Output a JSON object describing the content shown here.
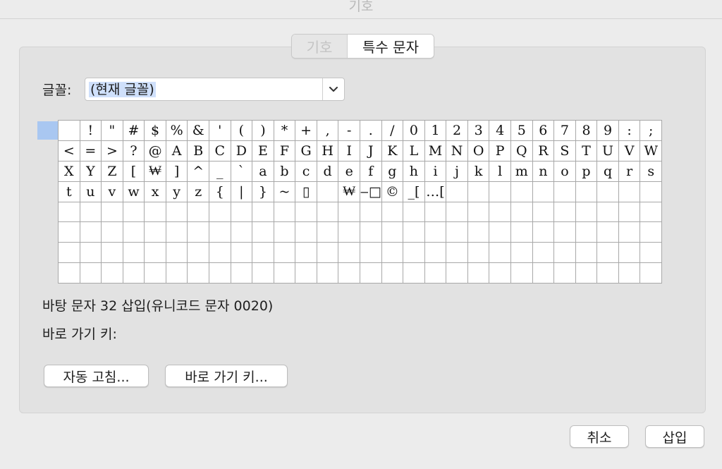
{
  "window": {
    "title": "기호"
  },
  "tabs": [
    {
      "label": "기호",
      "active": false
    },
    {
      "label": "특수 문자",
      "active": true
    }
  ],
  "font": {
    "label": "글꼴:",
    "value": "(현재 글꼴)",
    "dropdown_icon": "chevron-down-icon"
  },
  "grid": {
    "columns": 28,
    "rows": 8,
    "chars": [
      " ",
      "!",
      "\"",
      "#",
      "$",
      "%",
      "&",
      "'",
      "(",
      ")",
      "*",
      "+",
      ",",
      "-",
      ".",
      "/",
      "0",
      "1",
      "2",
      "3",
      "4",
      "5",
      "6",
      "7",
      "8",
      "9",
      ":",
      ";",
      "<",
      "=",
      ">",
      "?",
      "@",
      "A",
      "B",
      "C",
      "D",
      "E",
      "F",
      "G",
      "H",
      "I",
      "J",
      "K",
      "L",
      "M",
      "N",
      "O",
      "P",
      "Q",
      "R",
      "S",
      "T",
      "U",
      "V",
      "W",
      "X",
      "Y",
      "Z",
      "[",
      "₩",
      "]",
      "^",
      "_",
      "`",
      "a",
      "b",
      "c",
      "d",
      "e",
      "f",
      "g",
      "h",
      "i",
      "j",
      "k",
      "l",
      "m",
      "n",
      "o",
      "p",
      "q",
      "r",
      "s",
      "t",
      "u",
      "v",
      "w",
      "x",
      "y",
      "z",
      "{",
      "|",
      "}",
      "~",
      "▯",
      "",
      "₩",
      "‒□",
      "©",
      "_[",
      "…[",
      "",
      "",
      "",
      "",
      "",
      "",
      "",
      "",
      "",
      ""
    ],
    "selected_index": 0,
    "selection_color": "#a9c7f1"
  },
  "info_text": "바탕 문자 32 삽입(유니코드 문자 0020)",
  "shortcut_label": "바로 가기 키:",
  "buttons": {
    "autocorrect": "자동 고침...",
    "shortcut_key": "바로 가기 키...",
    "cancel": "취소",
    "insert": "삽입"
  }
}
